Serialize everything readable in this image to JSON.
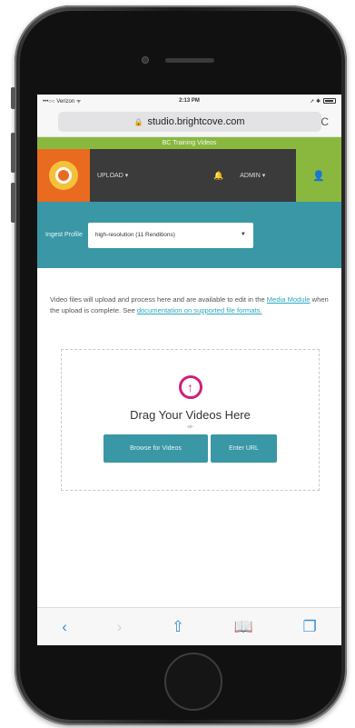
{
  "status_bar": {
    "carrier": "•••○○ Verizon ᯤ",
    "time": "2:13 PM",
    "right": "➚ ✱"
  },
  "browser": {
    "url": "studio.brightcove.com",
    "lock_glyph": "🔒",
    "reload_glyph": "C"
  },
  "account_banner": "BC Training Videos",
  "nav": {
    "upload_label": "UPLOAD ▾",
    "bell_glyph": "🔔",
    "admin_label": "ADMIN ▾",
    "user_glyph": "👤"
  },
  "ingest": {
    "label": "Ingest Profile",
    "selected": "high-resolution (11 Renditions)",
    "caret": "▼"
  },
  "info": {
    "text_1": "Video files will upload and process here and are available to edit in the ",
    "link_1": "Media Module",
    "text_2": " when the upload is complete. See ",
    "link_2": "documentation on supported file formats."
  },
  "dropzone": {
    "title": "Drag Your Videos Here",
    "or": "-or-",
    "browse_label": "Browse for Videos",
    "url_label": "Enter URL"
  },
  "toolbar": {
    "back": "‹",
    "forward": "›",
    "share": "⇧",
    "bookmarks": "📖",
    "tabs": "❐"
  },
  "colors": {
    "teal": "#3a97a5",
    "green": "#8ab83f",
    "orange": "#e96b1f",
    "magenta": "#cf1f7a",
    "ios_blue": "#3a8fd6"
  }
}
